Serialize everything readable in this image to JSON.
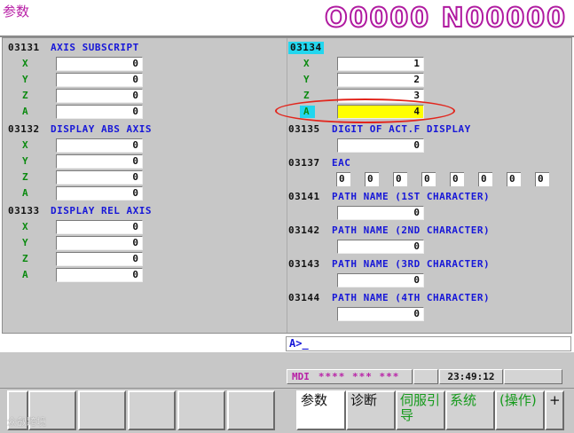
{
  "header": {
    "screen_name": "参数",
    "program_number": "O0000 N00000"
  },
  "left_params": [
    {
      "number": "03131",
      "name": "AXIS SUBSCRIPT",
      "axes": [
        {
          "axis": "X",
          "value": "0"
        },
        {
          "axis": "Y",
          "value": "0"
        },
        {
          "axis": "Z",
          "value": "0"
        },
        {
          "axis": "A",
          "value": "0"
        }
      ]
    },
    {
      "number": "03132",
      "name": "DISPLAY ABS AXIS",
      "axes": [
        {
          "axis": "X",
          "value": "0"
        },
        {
          "axis": "Y",
          "value": "0"
        },
        {
          "axis": "Z",
          "value": "0"
        },
        {
          "axis": "A",
          "value": "0"
        }
      ]
    },
    {
      "number": "03133",
      "name": "DISPLAY REL AXIS",
      "axes": [
        {
          "axis": "X",
          "value": "0"
        },
        {
          "axis": "Y",
          "value": "0"
        },
        {
          "axis": "Z",
          "value": "0"
        },
        {
          "axis": "A",
          "value": "0"
        }
      ]
    }
  ],
  "right_params": {
    "p03134": {
      "number": "03134",
      "axes": [
        {
          "axis": "X",
          "value": "1"
        },
        {
          "axis": "Y",
          "value": "2"
        },
        {
          "axis": "Z",
          "value": "3"
        },
        {
          "axis": "A",
          "value": "4"
        }
      ]
    },
    "p03135": {
      "number": "03135",
      "name": "DIGIT OF ACT.F DISPLAY",
      "value": "0"
    },
    "p03137": {
      "number": "03137",
      "name": "EAC",
      "bits": [
        "0",
        "0",
        "0",
        "0",
        "0",
        "0",
        "0",
        "0"
      ]
    },
    "p03141": {
      "number": "03141",
      "name": "PATH NAME (1ST CHARACTER)",
      "value": "0"
    },
    "p03142": {
      "number": "03142",
      "name": "PATH NAME (2ND CHARACTER)",
      "value": "0"
    },
    "p03143": {
      "number": "03143",
      "name": "PATH NAME (3RD CHARACTER)",
      "value": "0"
    },
    "p03144": {
      "number": "03144",
      "name": "PATH NAME (4TH CHARACTER)",
      "value": "0"
    }
  },
  "input_line": "A>_",
  "status": {
    "mode": "MDI",
    "alarm": "**** *** ***",
    "time": "23:49:12"
  },
  "softkeys": [
    "参数",
    "诊断",
    "伺服引导",
    "系统",
    "(操作)",
    "+"
  ],
  "watermark": "众叡跨境",
  "colors": {
    "background": "#c7c7c7",
    "param_name": "#1717d8",
    "axis_label": "#0b8a10",
    "selection": "#22d6ee",
    "cursor_field": "#ffff00",
    "header_accent": "#b81fa6",
    "annotation_ring": "#e2251c"
  }
}
